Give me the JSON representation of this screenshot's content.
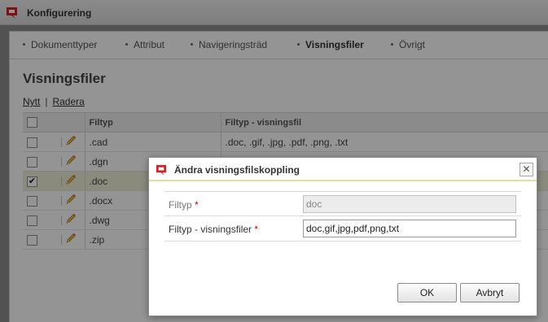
{
  "window": {
    "title": "Konfigurering",
    "brand_color": "#d72027"
  },
  "tabs": [
    {
      "label": "Dokumenttyper",
      "active": false
    },
    {
      "label": "Attribut",
      "active": false
    },
    {
      "label": "Navigeringsträd",
      "active": false
    },
    {
      "label": "Visningsfiler",
      "active": true
    },
    {
      "label": "Övrigt",
      "active": false
    }
  ],
  "page": {
    "title": "Visningsfiler",
    "new_link": "Nytt",
    "separator": "|",
    "delete_link": "Radera"
  },
  "table": {
    "columns": [
      "Filtyp",
      "Filtyp - visningsfil"
    ],
    "rows": [
      {
        "filetype": ".cad",
        "viewfiles": ".doc, .gif, .jpg, .pdf, .png, .txt",
        "checked": false
      },
      {
        "filetype": ".dgn",
        "viewfiles": "",
        "checked": false
      },
      {
        "filetype": ".doc",
        "viewfiles": "",
        "checked": true
      },
      {
        "filetype": ".docx",
        "viewfiles": "",
        "checked": false
      },
      {
        "filetype": ".dwg",
        "viewfiles": "",
        "checked": false
      },
      {
        "filetype": ".zip",
        "viewfiles": "",
        "checked": false
      }
    ]
  },
  "dialog": {
    "title": "Ändra visningsfilskoppling",
    "close_icon": "close-icon",
    "fields": {
      "filetype_label": "Filtyp",
      "filetype_value": "doc",
      "viewfiles_label": "Filtyp - visningsfiler",
      "viewfiles_value": "doc,gif,jpg,pdf,png,txt",
      "required_mark": "*"
    },
    "ok_label": "OK",
    "cancel_label": "Avbryt"
  }
}
